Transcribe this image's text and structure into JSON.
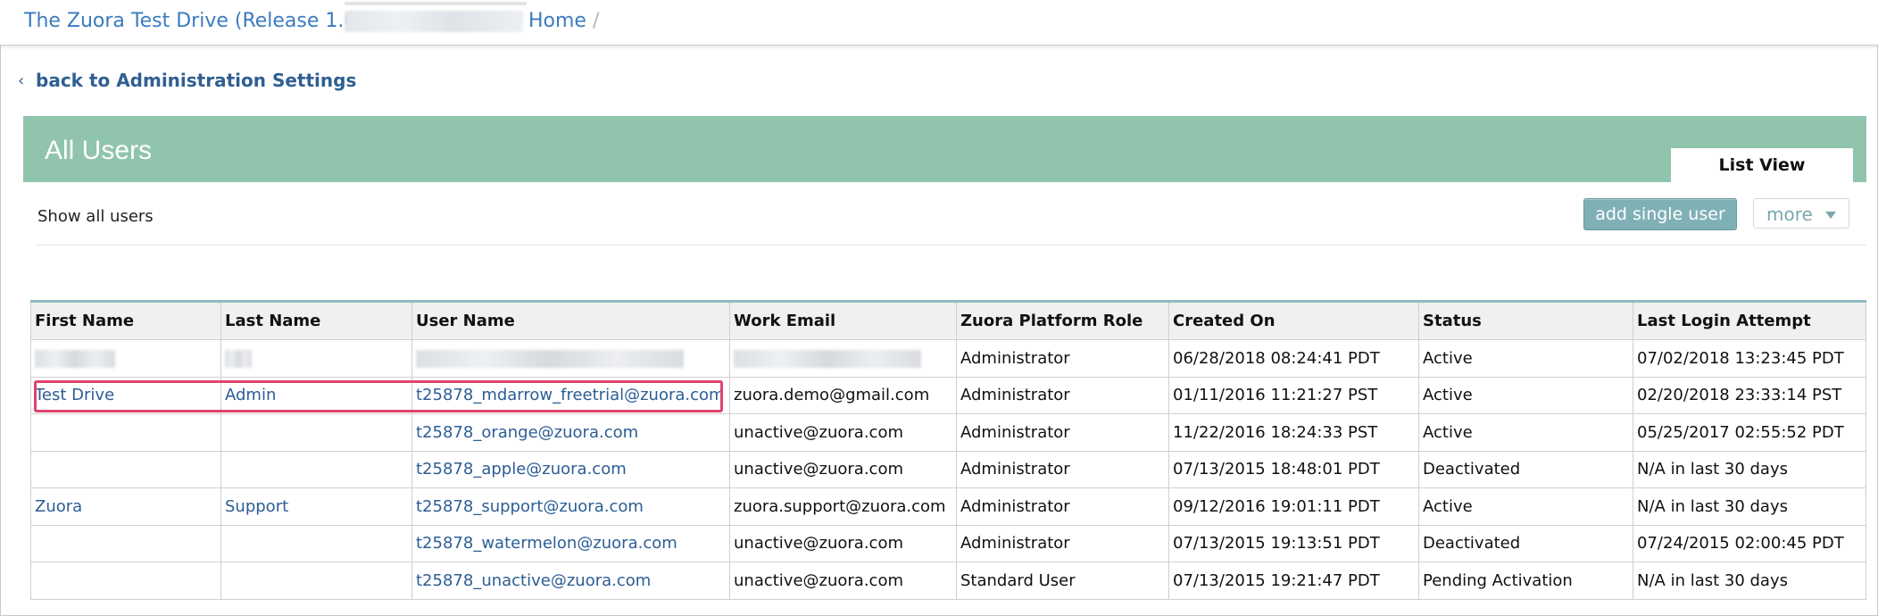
{
  "breadcrumb": {
    "app": "The Zuora Test Drive (Release 1.0)",
    "home": "Home",
    "separator": "/"
  },
  "back_link": {
    "chevron": "‹",
    "label": "back to Administration Settings"
  },
  "header": {
    "title": "All Users",
    "tab": "List View"
  },
  "toolbar": {
    "filter_label": "Show all users",
    "add_button": "add single user",
    "more_button": "more"
  },
  "table": {
    "columns": [
      "First Name",
      "Last Name",
      "User Name",
      "Work Email",
      "Zuora Platform Role",
      "Created On",
      "Status",
      "Last Login Attempt"
    ],
    "rows": [
      {
        "first": "",
        "last": "",
        "username": "",
        "email": "",
        "role": "Administrator",
        "created": "06/28/2018 08:24:41 PDT",
        "status": "Active",
        "last_login": "07/02/2018 13:23:45 PDT",
        "redacted": true
      },
      {
        "first": "Test Drive",
        "last": "Admin",
        "username": "t25878_mdarrow_freetrial@zuora.com",
        "email": "zuora.demo@gmail.com",
        "role": "Administrator",
        "created": "01/11/2016 11:21:27 PST",
        "status": "Active",
        "last_login": "02/20/2018 23:33:14 PST"
      },
      {
        "first": "",
        "last": "",
        "username": "t25878_orange@zuora.com",
        "email": "unactive@zuora.com",
        "role": "Administrator",
        "created": "11/22/2016 18:24:33 PST",
        "status": "Active",
        "last_login": "05/25/2017 02:55:52 PDT"
      },
      {
        "first": "",
        "last": "",
        "username": "t25878_apple@zuora.com",
        "email": "unactive@zuora.com",
        "role": "Administrator",
        "created": "07/13/2015 18:48:01 PDT",
        "status": "Deactivated",
        "last_login": "N/A in last 30 days"
      },
      {
        "first": "Zuora",
        "last": "Support",
        "username": "t25878_support@zuora.com",
        "email": "zuora.support@zuora.com",
        "role": "Administrator",
        "created": "09/12/2016 19:01:11 PDT",
        "status": "Active",
        "last_login": "N/A in last 30 days"
      },
      {
        "first": "",
        "last": "",
        "username": "t25878_watermelon@zuora.com",
        "email": "unactive@zuora.com",
        "role": "Administrator",
        "created": "07/13/2015 19:13:51 PDT",
        "status": "Deactivated",
        "last_login": "07/24/2015 02:00:45 PDT"
      },
      {
        "first": "",
        "last": "",
        "username": "t25878_unactive@zuora.com",
        "email": "unactive@zuora.com",
        "role": "Standard User",
        "created": "07/13/2015 19:21:47 PDT",
        "status": "Pending Activation",
        "last_login": "N/A in last 30 days"
      }
    ]
  },
  "colors": {
    "banner": "#91c4ad",
    "link": "#2c5d95",
    "highlight": "#e0436d",
    "add_button": "#7fb0b6"
  }
}
